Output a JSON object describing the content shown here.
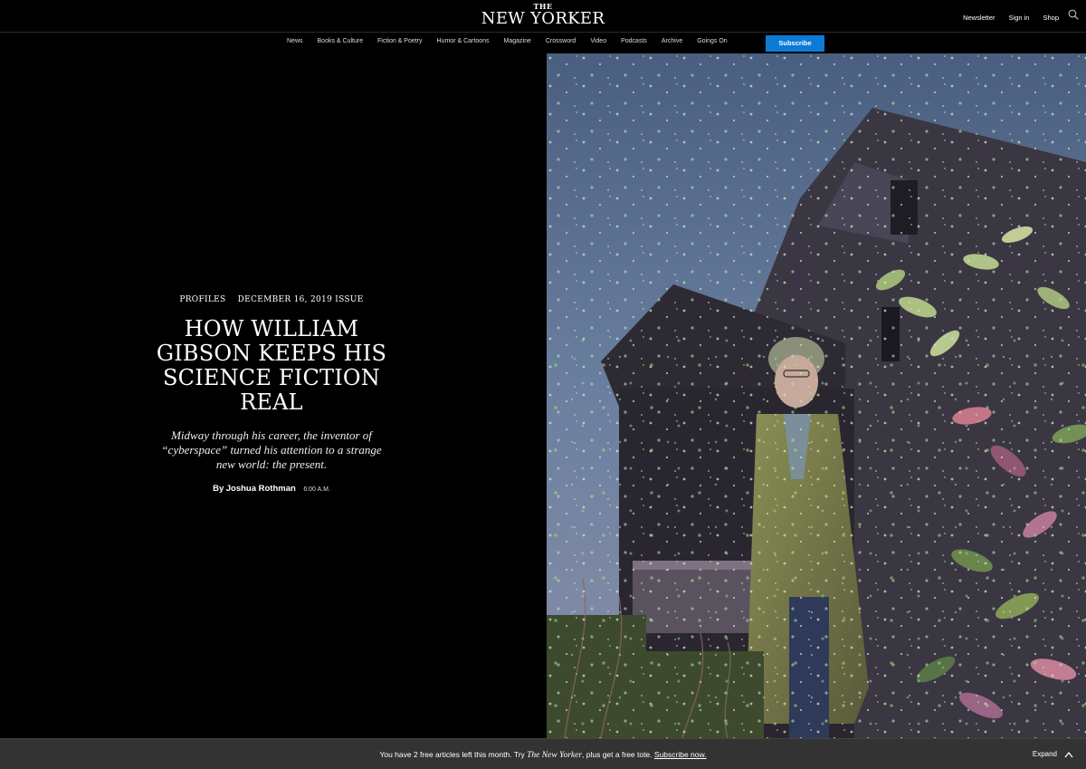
{
  "header": {
    "logo_top": "THE",
    "logo_main": "NEW YORKER",
    "utility_links": [
      "Newsletter",
      "Sign in",
      "Shop"
    ],
    "icons": {
      "search": "search-icon"
    }
  },
  "nav": {
    "items": [
      "News",
      "Books & Culture",
      "Fiction & Poetry",
      "Humor & Cartoons",
      "Magazine",
      "Crossword",
      "Video",
      "Podcasts",
      "Archive",
      "Goings On"
    ],
    "subscribe_label": "Subscribe",
    "subscribe_color": "#0c7bd6"
  },
  "article": {
    "rubric": "PROFILES",
    "issue": "DECEMBER 16, 2019 ISSUE",
    "headline": "HOW WILLIAM GIBSON KEEPS HIS SCIENCE FICTION REAL",
    "dek": "Midway through his career, the inventor of “cyberspace” turned his attention to a strange new world: the present.",
    "byline_prefix": "By",
    "author": "Joshua Rothman",
    "time": "6:00 A.M."
  },
  "photo": {
    "subject": "photo of man in coat before a house at dusk with sparkles"
  },
  "paywall": {
    "text_before": "You have 2 free articles left this month. Try ",
    "publication": "The New Yorker",
    "text_after": ", plus get a free tote. ",
    "link": "Subscribe now.",
    "expand_label": "Expand",
    "icons": {
      "expand": "chevron-up-icon"
    }
  },
  "colors": {
    "background": "#000000",
    "paywall_bar": "#333333"
  }
}
